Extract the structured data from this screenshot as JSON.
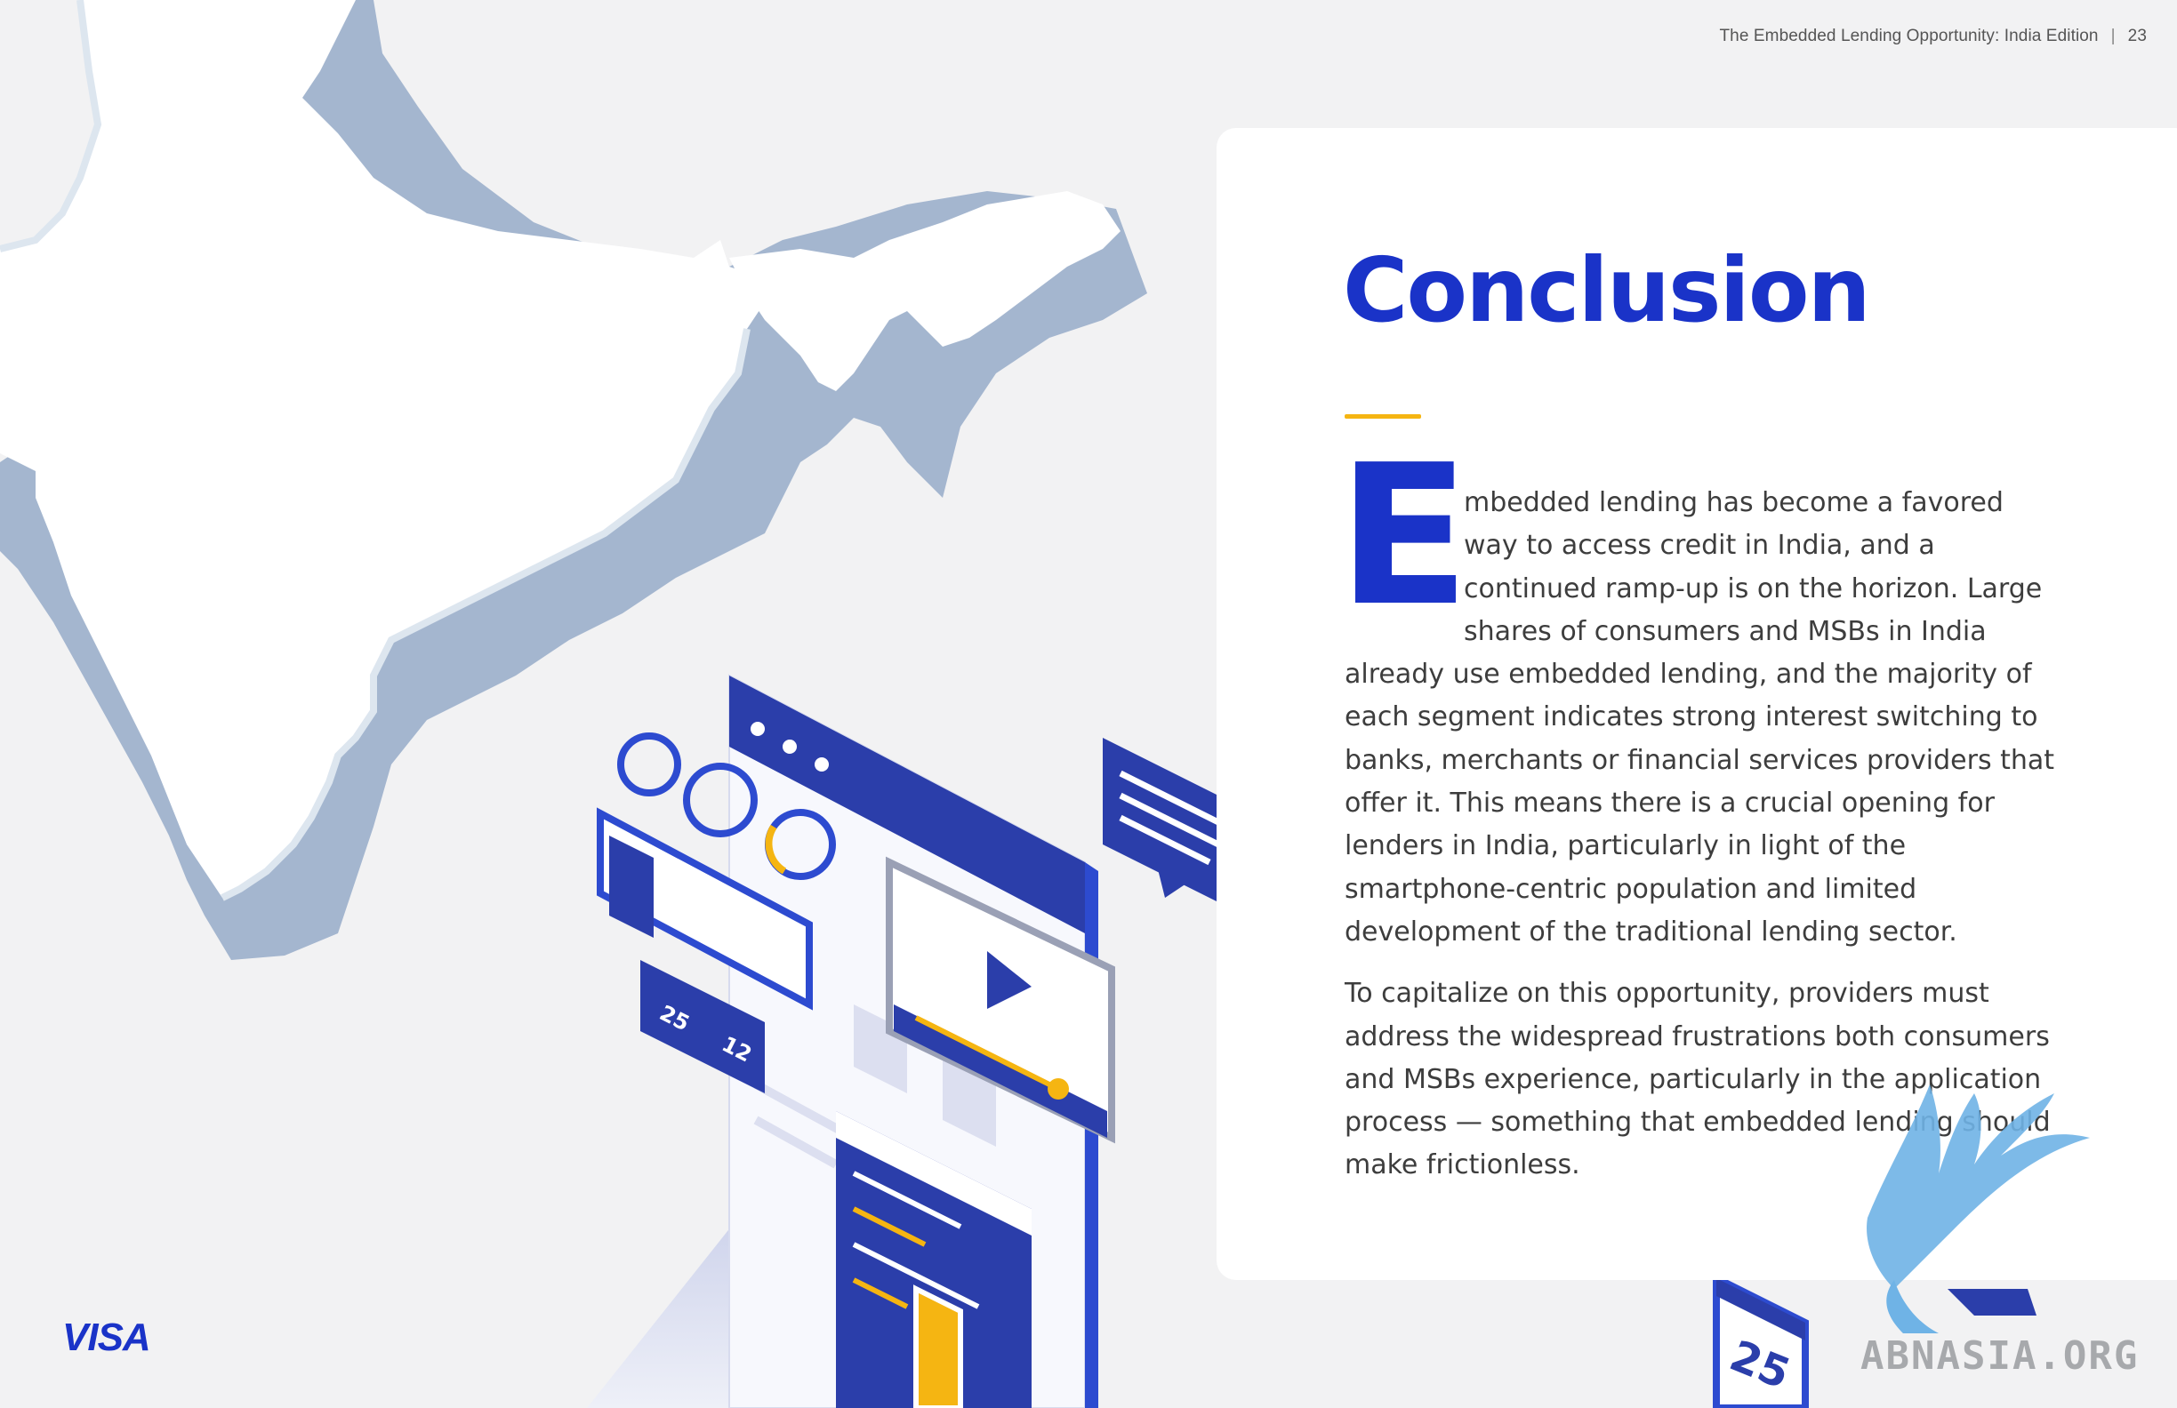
{
  "header": {
    "report_title": "The Embedded Lending Opportunity: India Edition",
    "separator": "|",
    "page_number": "23"
  },
  "content": {
    "title": "Conclusion",
    "dropcap": "E",
    "paragraph1_rest": "mbedded lending has become a favored way to access credit in India, and a continued ramp-up is on the horizon. Large shares of consumers and MSBs in India already use embedded lending, and the majority of each segment indicates strong interest switching to banks, merchants or financial services providers that offer it. This means there is a crucial opening for lenders in India, particularly in light of the smartphone-centric population and limited development of the traditional lending sector.",
    "paragraph2": "To capitalize on this opportunity, providers must address the widespread frustrations both consumers and MSBs experience, particularly in the application process — something that embedded lending should make frictionless."
  },
  "illustration": {
    "likes_count": "25",
    "comments_count": "12",
    "calendar_day": "25"
  },
  "footer": {
    "brand_logo": "VISA"
  },
  "watermark": {
    "text": "ABNASIA.ORG"
  },
  "colors": {
    "brand_blue": "#1a33c8",
    "accent_yellow": "#f5b512",
    "map_shadow": "#a4b6cf"
  }
}
